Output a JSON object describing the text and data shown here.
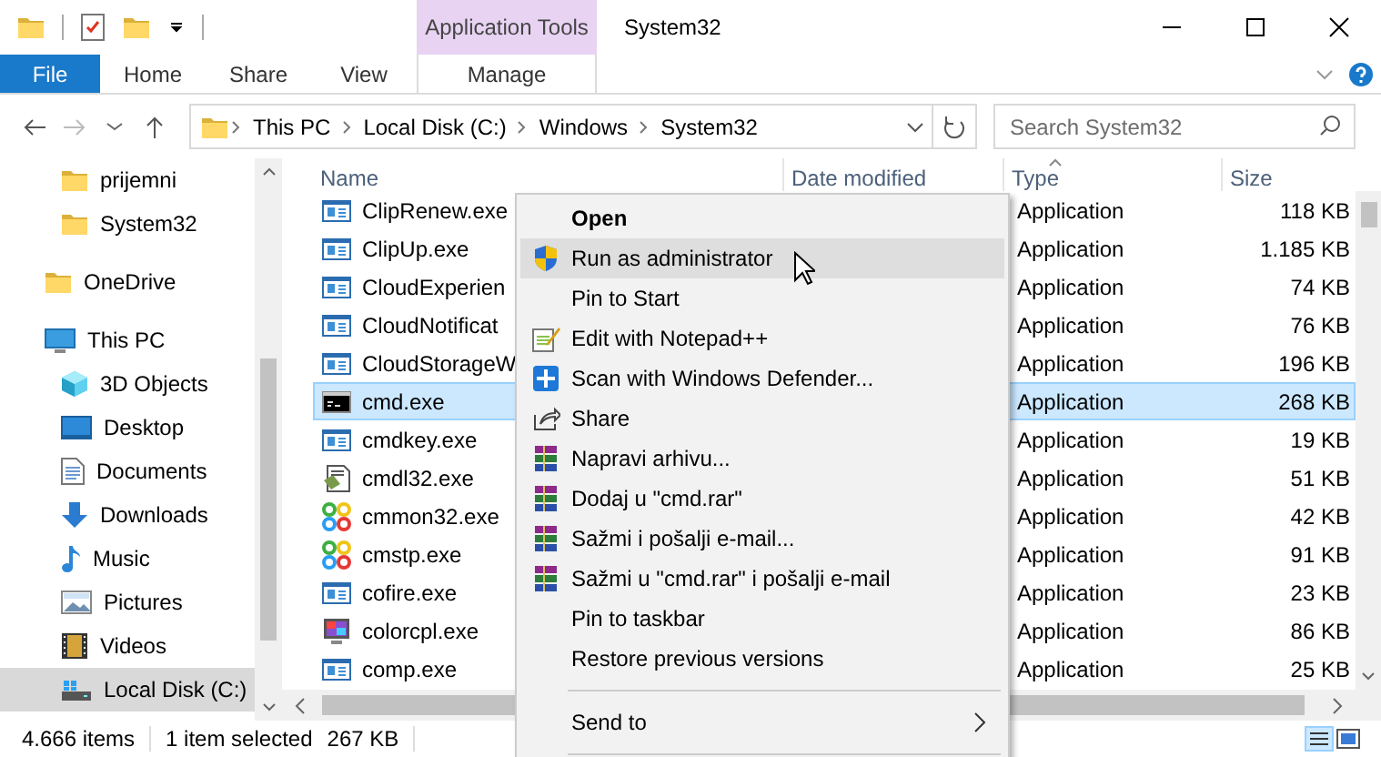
{
  "window": {
    "title": "System32",
    "contextual_group": "Application Tools"
  },
  "ribbon": {
    "tabs": [
      {
        "label": "File",
        "kind": "file",
        "selected": false
      },
      {
        "label": "Home",
        "kind": "normal",
        "selected": false
      },
      {
        "label": "Share",
        "kind": "normal",
        "selected": false
      },
      {
        "label": "View",
        "kind": "normal",
        "selected": false
      },
      {
        "label": "Manage",
        "kind": "contextual",
        "selected": false
      }
    ]
  },
  "address_bar": {
    "crumbs": [
      "This PC",
      "Local Disk (C:)",
      "Windows",
      "System32"
    ]
  },
  "search": {
    "placeholder": "Search System32"
  },
  "nav_pane": {
    "scrolled_parent_children": [
      {
        "label": "prijemni",
        "kind": "folder",
        "selected": false
      },
      {
        "label": "System32",
        "kind": "folder",
        "selected": false
      }
    ],
    "items": [
      {
        "label": "OneDrive",
        "kind": "folder",
        "selected": false
      },
      {
        "label": "This PC",
        "kind": "pc",
        "selected": false,
        "children": [
          {
            "label": "3D Objects",
            "kind": "cube",
            "selected": false
          },
          {
            "label": "Desktop",
            "kind": "desktop",
            "selected": false
          },
          {
            "label": "Documents",
            "kind": "documents",
            "selected": false
          },
          {
            "label": "Downloads",
            "kind": "downloads",
            "selected": false
          },
          {
            "label": "Music",
            "kind": "music",
            "selected": false
          },
          {
            "label": "Pictures",
            "kind": "pictures",
            "selected": false
          },
          {
            "label": "Videos",
            "kind": "videos",
            "selected": false
          },
          {
            "label": "Local Disk (C:)",
            "kind": "drive",
            "selected": true
          }
        ]
      }
    ]
  },
  "file_list": {
    "columns": [
      {
        "label": "Name",
        "sorted": false
      },
      {
        "label": "Date modified",
        "sorted": false
      },
      {
        "label": "Type",
        "sorted": true
      },
      {
        "label": "Size",
        "sorted": false
      }
    ],
    "rows": [
      {
        "name": "ClipRenew.exe",
        "kind": "app",
        "type": "Application",
        "size": "118 KB",
        "selected": false
      },
      {
        "name": "ClipUp.exe",
        "kind": "app",
        "type": "Application",
        "size": "1.185 KB",
        "selected": false
      },
      {
        "name": "CloudExperien",
        "kind": "app",
        "type": "Application",
        "size": "74 KB",
        "selected": false
      },
      {
        "name": "CloudNotificat",
        "kind": "app",
        "type": "Application",
        "size": "76 KB",
        "selected": false
      },
      {
        "name": "CloudStorageW",
        "kind": "app",
        "type": "Application",
        "size": "196 KB",
        "selected": false
      },
      {
        "name": "cmd.exe",
        "kind": "console",
        "type": "Application",
        "size": "268 KB",
        "selected": true
      },
      {
        "name": "cmdkey.exe",
        "kind": "app",
        "type": "Application",
        "size": "19 KB",
        "selected": false
      },
      {
        "name": "cmdl32.exe",
        "kind": "document",
        "type": "Application",
        "size": "51 KB",
        "selected": false
      },
      {
        "name": "cmmon32.exe",
        "kind": "knot",
        "type": "Application",
        "size": "42 KB",
        "selected": false
      },
      {
        "name": "cmstp.exe",
        "kind": "knot",
        "type": "Application",
        "size": "91 KB",
        "selected": false
      },
      {
        "name": "cofire.exe",
        "kind": "app",
        "type": "Application",
        "size": "23 KB",
        "selected": false
      },
      {
        "name": "colorcpl.exe",
        "kind": "monitor",
        "type": "Application",
        "size": "86 KB",
        "selected": false
      },
      {
        "name": "comp.exe",
        "kind": "app",
        "type": "Application",
        "size": "25 KB",
        "selected": false
      }
    ]
  },
  "context_menu": {
    "items": [
      {
        "label": "Open",
        "kind": "default",
        "highlighted": false
      },
      {
        "label": "Run as administrator",
        "kind": "admin",
        "highlighted": true
      },
      {
        "label": "Pin to Start",
        "kind": "command",
        "highlighted": false
      },
      {
        "label": "Edit with Notepad++",
        "kind": "editor",
        "highlighted": false
      },
      {
        "label": "Scan with Windows Defender...",
        "kind": "scan",
        "highlighted": false
      },
      {
        "label": "Share",
        "kind": "share",
        "highlighted": false
      },
      {
        "label": "Napravi arhivu...",
        "kind": "archive",
        "highlighted": false
      },
      {
        "label": "Dodaj u \"cmd.rar\"",
        "kind": "archive",
        "highlighted": false
      },
      {
        "label": "Sažmi i pošalji e-mail...",
        "kind": "archive",
        "highlighted": false
      },
      {
        "label": "Sažmi u \"cmd.rar\" i pošalji e-mail",
        "kind": "archive",
        "highlighted": false
      },
      {
        "label": "Pin to taskbar",
        "kind": "command",
        "highlighted": false
      },
      {
        "label": "Restore previous versions",
        "kind": "command",
        "highlighted": false
      },
      {
        "kind": "separator"
      },
      {
        "label": "Send to",
        "kind": "submenu",
        "highlighted": false
      },
      {
        "kind": "separator"
      }
    ]
  },
  "status_bar": {
    "item_count": "4.666 items",
    "selection": "1 item selected",
    "selection_size": "267 KB"
  }
}
